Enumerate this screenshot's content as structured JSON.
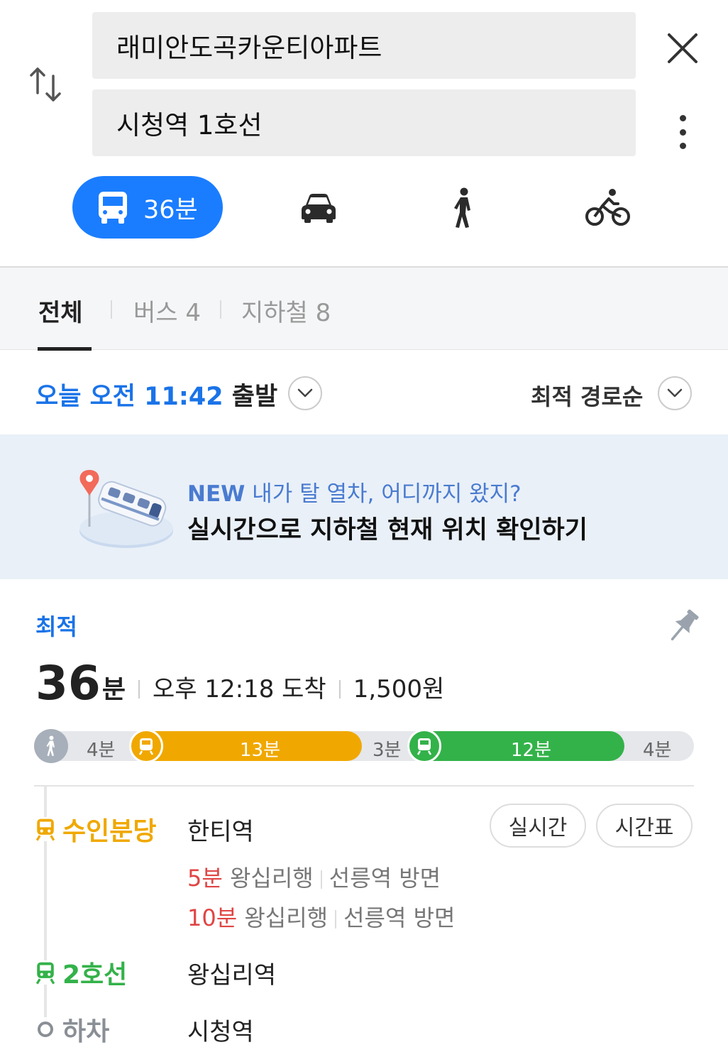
{
  "search": {
    "origin": "래미안도곡카운티아파트",
    "destination": "시청역 1호선"
  },
  "modes": {
    "transit_time": "36분"
  },
  "tabs": [
    {
      "label": "전체"
    },
    {
      "label": "버스 4"
    },
    {
      "label": "지하철 8"
    }
  ],
  "departure": {
    "time": "오늘 오전 11:42",
    "suffix": " 출발",
    "sort": "최적 경로순"
  },
  "banner": {
    "new_tag": "NEW",
    "line1": " 내가 탈 열차, 어디까지 왔지?",
    "line2": "실시간으로 지하철 현재 위치 확인하기"
  },
  "route": {
    "badge": "최적",
    "duration_num": "36",
    "duration_unit": "분",
    "arrival": "오후 12:18 도착",
    "fare": "1,500원",
    "segments": {
      "walk1": "4분",
      "line1": "13분",
      "walk2": "3분",
      "line2": "12분",
      "walk3": "4분"
    },
    "colors": {
      "suin": "#f0a800",
      "line2": "#33b249",
      "primary": "#1a7dff"
    },
    "steps": {
      "board_line": "수인분당",
      "board_station": "한티역",
      "realtime_btn": "실시간",
      "timetable_btn": "시간표",
      "arrivals": [
        {
          "min": "5분",
          "dest": "왕십리행",
          "dir": "선릉역 방면"
        },
        {
          "min": "10분",
          "dest": "왕십리행",
          "dir": "선릉역 방면"
        }
      ],
      "transfer_line": "2호선",
      "transfer_station": "왕십리역",
      "alight_label": "하차",
      "alight_station": "시청역"
    }
  }
}
